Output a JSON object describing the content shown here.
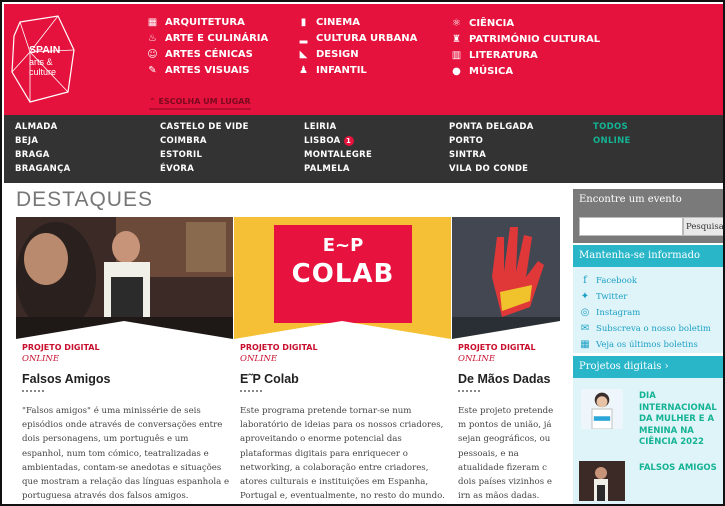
{
  "logo": {
    "line1": "SPAIN",
    "line2": "arts &",
    "line3": "culture"
  },
  "categories": [
    {
      "label": "ARQUITETURA",
      "icon": "building-icon"
    },
    {
      "label": "ARTE E CULINÁRIA",
      "icon": "chef-hat-icon"
    },
    {
      "label": "ARTES CÉNICAS",
      "icon": "theater-masks-icon"
    },
    {
      "label": "ARTES VISUAIS",
      "icon": "palette-icon"
    },
    {
      "label": "CINEMA",
      "icon": "film-icon"
    },
    {
      "label": "CULTURA URBANA",
      "icon": "sneaker-icon"
    },
    {
      "label": "DESIGN",
      "icon": "ruler-triangle-icon"
    },
    {
      "label": "INFANTIL",
      "icon": "child-icon"
    },
    {
      "label": "CIÊNCIA",
      "icon": "atom-icon"
    },
    {
      "label": "PATRIMÓNIO CULTURAL",
      "icon": "monument-icon"
    },
    {
      "label": "LITERATURA",
      "icon": "book-icon"
    },
    {
      "label": "MÚSICA",
      "icon": "music-icon"
    }
  ],
  "escolha": "ESCOLHA UM LUGAR",
  "cities": {
    "col1": [
      "ALMADA",
      "BEJA",
      "BRAGA",
      "BRAGANÇA"
    ],
    "col2": [
      "CASTELO DE VIDE",
      "COIMBRA",
      "ESTORIL",
      "ÉVORA"
    ],
    "col3": [
      "LEIRIA",
      "LISBOA",
      "MONTALEGRE",
      "PALMELA"
    ],
    "col4": [
      "PONTA DELGADA",
      "PORTO",
      "SINTRA",
      "VILA DO CONDE"
    ],
    "col5": [
      "TODOS",
      "ONLINE"
    ],
    "lisboa_badge": "1"
  },
  "section_title": "DESTAQUES",
  "cards": [
    {
      "tag": "PROJETO DIGITAL",
      "sub": "ONLINE",
      "title": "Falsos Amigos",
      "desc": "\"Falsos amigos\" é uma minissérie de seis episódios onde através de conversações entre dois personagens, um português e um espanhol, num tom cómico, teatralizadas e ambientadas, contam-se anedotas e situações que mostram a relação das línguas espanhola e portuguesa através dos falsos amigos."
    },
    {
      "tag": "PROJETO DIGITAL",
      "sub": "ONLINE",
      "title": "E˜P Colab",
      "desc": "Este programa pretende tornar-se num laboratório de ideias para os nossos criadores, aproveitando o enorme potencial das plataformas digitais para enriquecer o networking, a colaboração entre criadores, atores culturais e instituições em Espanha, Portugal e, eventualmente, no resto do mundo.",
      "poster_line1": "E~P",
      "poster_line2": "COLAB"
    },
    {
      "tag": "PROJETO DIGITAL",
      "sub": "ONLINE",
      "title": "De Mãos Dadas",
      "desc": "Este projeto pretende m pontos de união, já sejan geográficos, ou pessoais, e na atualidade fizeram c dois países vizinhos e irn as mãos dadas."
    }
  ],
  "sidebar": {
    "event_title": "Encontre um evento",
    "search_placeholder": "",
    "search_button": "Pesquisar",
    "informed_title": "Mantenha-se informado",
    "social": [
      {
        "label": "Facebook",
        "icon": "facebook-icon"
      },
      {
        "label": "Twitter",
        "icon": "twitter-icon"
      },
      {
        "label": "Instagram",
        "icon": "instagram-icon"
      },
      {
        "label": "Subscreva o nosso boletim",
        "icon": "envelope-icon"
      },
      {
        "label": "Veja os últimos boletins",
        "icon": "calendar-icon"
      }
    ],
    "projects_title": "Projetos digitais ›",
    "projects": [
      {
        "title": "DIA INTERNACIONAL DA MULHER E A MENINA NA CIÊNCIA 2022"
      },
      {
        "title": "FALSOS AMIGOS"
      }
    ]
  },
  "colors": {
    "brand_red": "#e5123d",
    "dark_bar": "#333333",
    "accent_teal": "#14b394",
    "sidebar_teal": "#2ab6c9",
    "sidebar_grey": "#7a7a7a",
    "poster_yellow": "#f5c035"
  }
}
